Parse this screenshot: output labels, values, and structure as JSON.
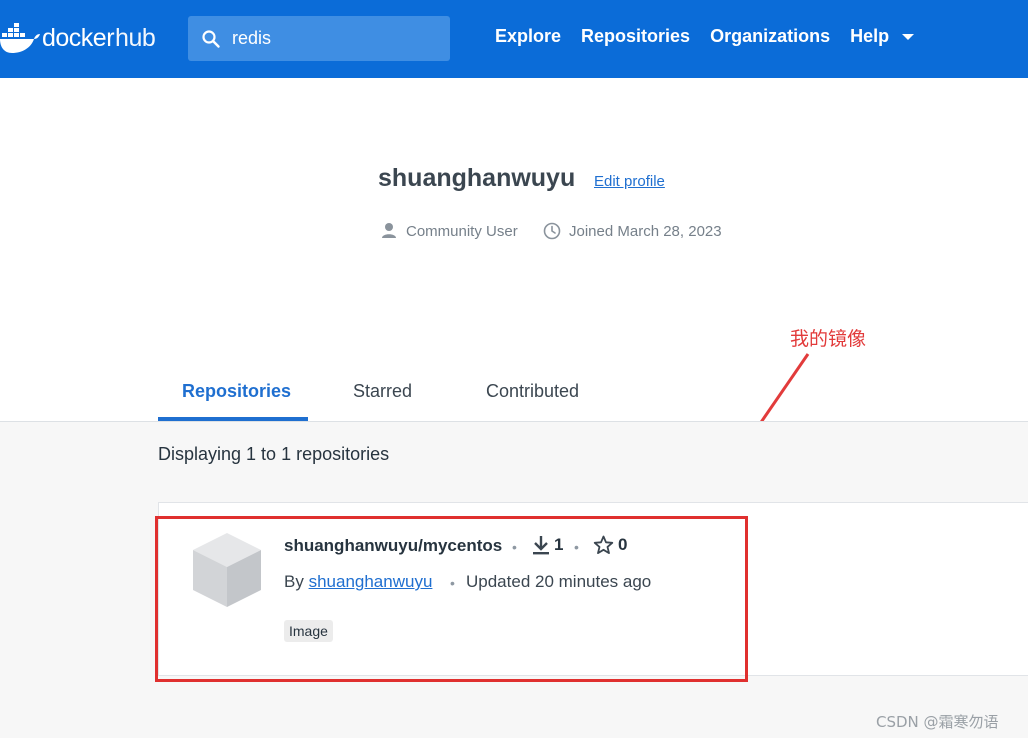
{
  "header": {
    "logo_docker": "docker",
    "logo_hub": "hub",
    "search_value": "redis",
    "nav": [
      "Explore",
      "Repositories",
      "Organizations",
      "Help"
    ]
  },
  "profile": {
    "name": "shuanghanwuyu",
    "edit_label": "Edit profile",
    "user_type": "Community User",
    "joined": "Joined March 28, 2023"
  },
  "annotation": "我的镜像",
  "tabs": [
    {
      "label": "Repositories",
      "active": true
    },
    {
      "label": "Starred",
      "active": false
    },
    {
      "label": "Contributed",
      "active": false
    }
  ],
  "content": {
    "displaying": "Displaying 1 to 1 repositories",
    "repo": {
      "name": "shuanghanwuyu/mycentos",
      "downloads": "1",
      "stars": "0",
      "by_prefix": "By",
      "by_user": "shuanghanwuyu",
      "updated": "Updated 20 minutes ago",
      "badge": "Image"
    }
  },
  "watermark": "CSDN @霜寒勿语",
  "colors": {
    "nav_blue": "#0b6cd8",
    "link_blue": "#1f6fd0",
    "annotation_red": "#e23b3b"
  },
  "icons": [
    "docker-whale-icon",
    "search-icon",
    "chevron-down-icon",
    "user-icon",
    "clock-icon",
    "download-icon",
    "star-icon",
    "cube-icon"
  ]
}
